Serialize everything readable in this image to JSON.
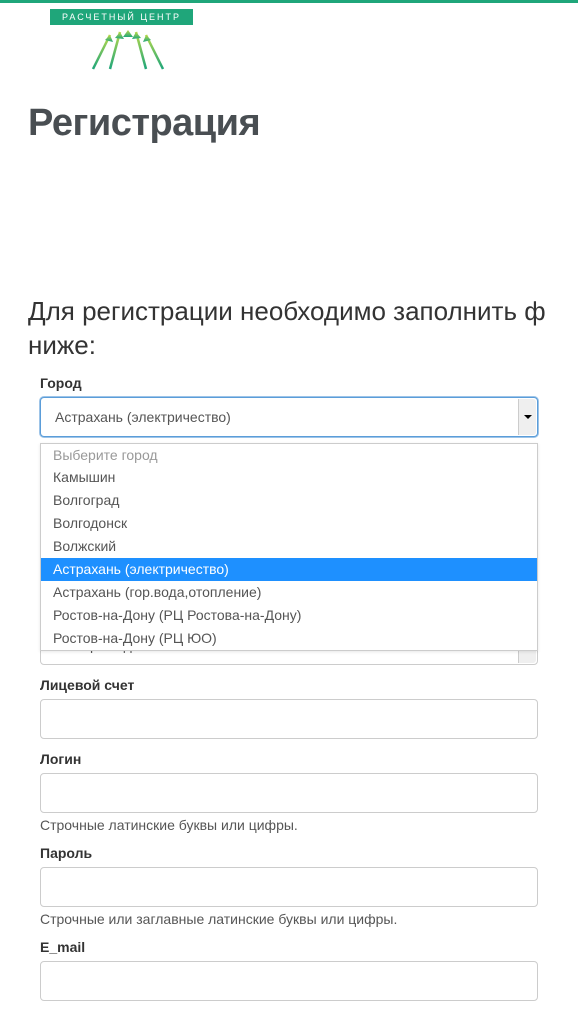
{
  "logo": {
    "badge_text": "РАСЧЕТНЫЙ ЦЕНТР"
  },
  "page": {
    "title": "Регистрация",
    "subtitle": "Для регистрации необходимо заполнить ф ниже:"
  },
  "form": {
    "city": {
      "label": "Город",
      "selected": "Астрахань (электричество)",
      "placeholder": "Выберите город",
      "options": [
        "Камышин",
        "Волгоград",
        "Волгодонск",
        "Волжский",
        "Астрахань (электричество)",
        "Астрахань (гор.вода,отопление)",
        "Ростов-на-Дону (РЦ Ростова-на-Дону)",
        "Ростов-на-Дону (РЦ ЮО)"
      ]
    },
    "house": {
      "placeholder": "Выберите дом"
    },
    "account": {
      "label": "Лицевой счет"
    },
    "login": {
      "label": "Логин",
      "help": "Строчные латинские буквы или цифры."
    },
    "password": {
      "label": "Пароль",
      "help": "Строчные или заглавные латинские буквы или цифры."
    },
    "email": {
      "label": "E_mail"
    }
  }
}
